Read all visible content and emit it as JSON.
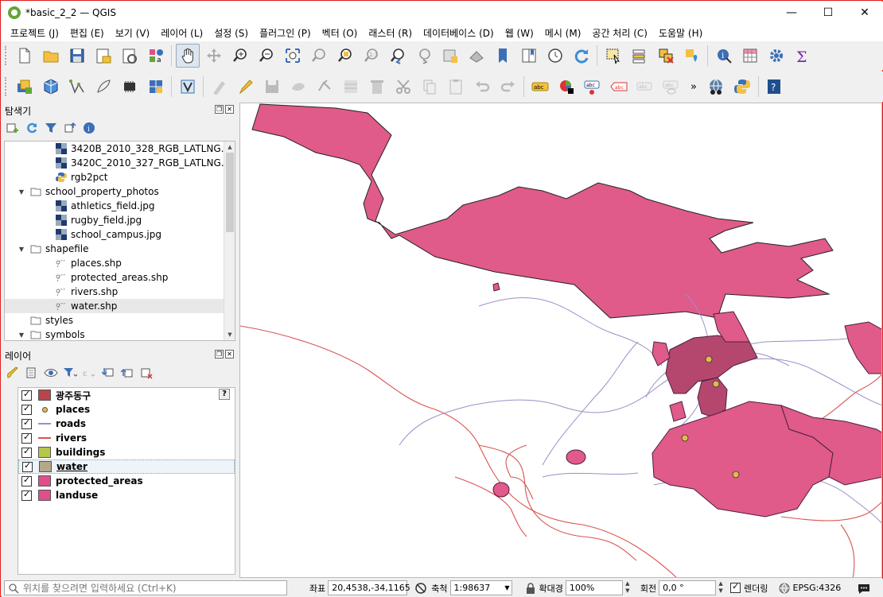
{
  "window": {
    "title": "*basic_2_2 — QGIS",
    "minimize": "—",
    "maximize": "☐",
    "close": "✕"
  },
  "menu": [
    "프로젝트 (J)",
    "편집 (E)",
    "보기 (V)",
    "레이어 (L)",
    "설정 (S)",
    "플러그인 (P)",
    "벡터 (O)",
    "래스터 (R)",
    "데이터베이스 (D)",
    "웹 (W)",
    "메시 (M)",
    "공간 처리 (C)",
    "도움말 (H)"
  ],
  "toolbar2": {
    "more": "»",
    "label_text": "abc"
  },
  "browser": {
    "title": "탐색기",
    "items": [
      {
        "label": "3420B_2010_328_RGB_LATLNG.tif",
        "type": "raster",
        "level": 2
      },
      {
        "label": "3420C_2010_327_RGB_LATLNG.tif",
        "type": "raster",
        "level": 2
      },
      {
        "label": "rgb2pct",
        "type": "python",
        "level": 2
      },
      {
        "label": "school_property_photos",
        "type": "folder",
        "level": 1,
        "expanded": true
      },
      {
        "label": "athletics_field.jpg",
        "type": "raster",
        "level": 2
      },
      {
        "label": "rugby_field.jpg",
        "type": "raster",
        "level": 2
      },
      {
        "label": "school_campus.jpg",
        "type": "raster",
        "level": 2
      },
      {
        "label": "shapefile",
        "type": "folder",
        "level": 1,
        "expanded": true
      },
      {
        "label": "places.shp",
        "type": "vector",
        "level": 2
      },
      {
        "label": "protected_areas.shp",
        "type": "vector",
        "level": 2
      },
      {
        "label": "rivers.shp",
        "type": "vector",
        "level": 2
      },
      {
        "label": "water.shp",
        "type": "vector",
        "level": 2,
        "selected": true
      },
      {
        "label": "styles",
        "type": "folder",
        "level": 1
      },
      {
        "label": "symbols",
        "type": "folder",
        "level": 1,
        "expanded": true
      }
    ]
  },
  "layers": {
    "title": "레이어",
    "help": "?",
    "items": [
      {
        "label": "광주동구",
        "symbol": "fill",
        "color": "#b5474b"
      },
      {
        "label": "places",
        "symbol": "point",
        "color": "#e6b84c"
      },
      {
        "label": "roads",
        "symbol": "line",
        "color": "#9d8fc7"
      },
      {
        "label": "rivers",
        "symbol": "line",
        "color": "#d9534f"
      },
      {
        "label": "buildings",
        "symbol": "fill",
        "color": "#b5c74a"
      },
      {
        "label": "water",
        "symbol": "fill",
        "color": "#b5a888",
        "selected": true
      },
      {
        "label": "protected_areas",
        "symbol": "fill",
        "color": "#e04f8a"
      },
      {
        "label": "landuse",
        "symbol": "fill",
        "color": "#e04f8a"
      }
    ]
  },
  "status": {
    "locator_placeholder": "위치를 찾으려면 입력하세요 (Ctrl+K)",
    "coord_label": "좌표",
    "coord_value": "20,4538,-34,1165",
    "scale_label": "축척",
    "scale_value": "1:98637",
    "mag_label": "확대경",
    "mag_value": "100%",
    "rot_label": "회전",
    "rot_value": "0,0 °",
    "render_label": "렌더링",
    "crs": "EPSG:4326"
  },
  "colors": {
    "polygon": "#e05a8a",
    "road": "#9d8fc7",
    "river": "#d9534f",
    "place": "#e6b84c"
  }
}
